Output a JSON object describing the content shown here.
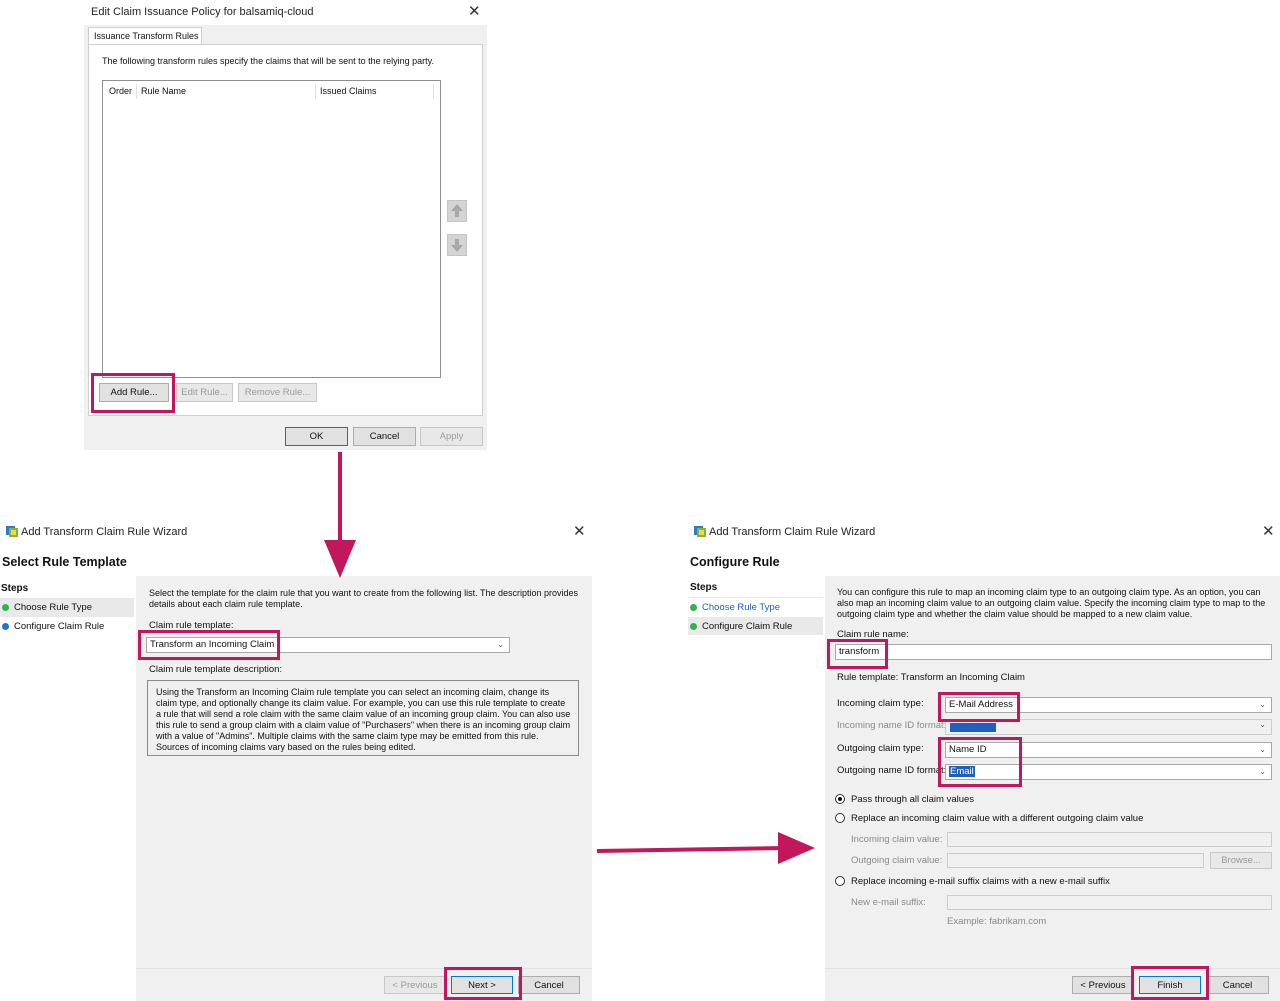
{
  "dialog1": {
    "title": "Edit Claim Issuance Policy for balsamiq-cloud",
    "tab": "Issuance Transform Rules",
    "intro": "The following transform rules specify the claims that will be sent to the relying party.",
    "columns": [
      "Order",
      "Rule Name",
      "Issued Claims"
    ],
    "buttons": {
      "add": "Add Rule...",
      "edit": "Edit Rule...",
      "remove": "Remove Rule...",
      "ok": "OK",
      "cancel": "Cancel",
      "apply": "Apply"
    }
  },
  "wizard1": {
    "title": "Add Transform Claim Rule Wizard",
    "heading": "Select Rule Template",
    "steps_label": "Steps",
    "steps": [
      "Choose Rule Type",
      "Configure Claim Rule"
    ],
    "intro": "Select the template for the claim rule that you want to create from the following list. The description provides details about each claim rule template.",
    "template_label": "Claim rule template:",
    "template_value": "Transform an Incoming Claim",
    "desc_label": "Claim rule template description:",
    "description": "Using the Transform an Incoming Claim rule template you can select an incoming claim, change its claim type, and optionally change its claim value.  For example, you can use this rule template to create a rule that will send a role claim with the same claim value of an incoming group claim.  You can also use this rule to send a group claim with a claim value of \"Purchasers\" when there is an incoming group claim with a value of \"Admins\".  Multiple claims with the same claim type may be emitted from this rule.  Sources of incoming claims vary based on the rules being edited.",
    "buttons": {
      "previous": "< Previous",
      "next": "Next >",
      "cancel": "Cancel"
    }
  },
  "wizard2": {
    "title": "Add Transform Claim Rule Wizard",
    "heading": "Configure Rule",
    "steps_label": "Steps",
    "steps": [
      "Choose Rule Type",
      "Configure Claim Rule"
    ],
    "intro": "You can configure this rule to map an incoming claim type to an outgoing claim type. As an option, you can also map an incoming claim value to an outgoing claim value. Specify the incoming claim type to map to the outgoing claim type and whether the claim value should be mapped to a new claim value.",
    "rule_name_label": "Claim rule name:",
    "rule_name_value": "transform",
    "rule_template": "Rule template: Transform an Incoming Claim",
    "incoming_type_label": "Incoming claim type:",
    "incoming_type_value": "E-Mail Address",
    "incoming_nameid_label": "Incoming name ID format:",
    "outgoing_type_label": "Outgoing claim type:",
    "outgoing_type_value": "Name ID",
    "outgoing_nameid_label": "Outgoing name ID format:",
    "outgoing_nameid_value": "Email",
    "radio_pass": "Pass through all claim values",
    "radio_replace": "Replace an incoming claim value with a different outgoing claim value",
    "incoming_value_label": "Incoming claim value:",
    "outgoing_value_label": "Outgoing claim value:",
    "browse": "Browse...",
    "radio_suffix": "Replace incoming e-mail suffix claims with a new e-mail suffix",
    "suffix_label": "New e-mail suffix:",
    "suffix_example": "Example: fabrikam.com",
    "buttons": {
      "previous": "< Previous",
      "finish": "Finish",
      "cancel": "Cancel"
    }
  },
  "colors": {
    "highlight": "#c2185b",
    "step_done": "#2db34a",
    "step_current": "#1f73d8",
    "selection": "#1f5fbf"
  },
  "icons": [
    "close-icon",
    "wizard-icon",
    "move-up-icon",
    "move-down-icon",
    "dropdown-arrow-icon",
    "flow-arrow-icon"
  ]
}
